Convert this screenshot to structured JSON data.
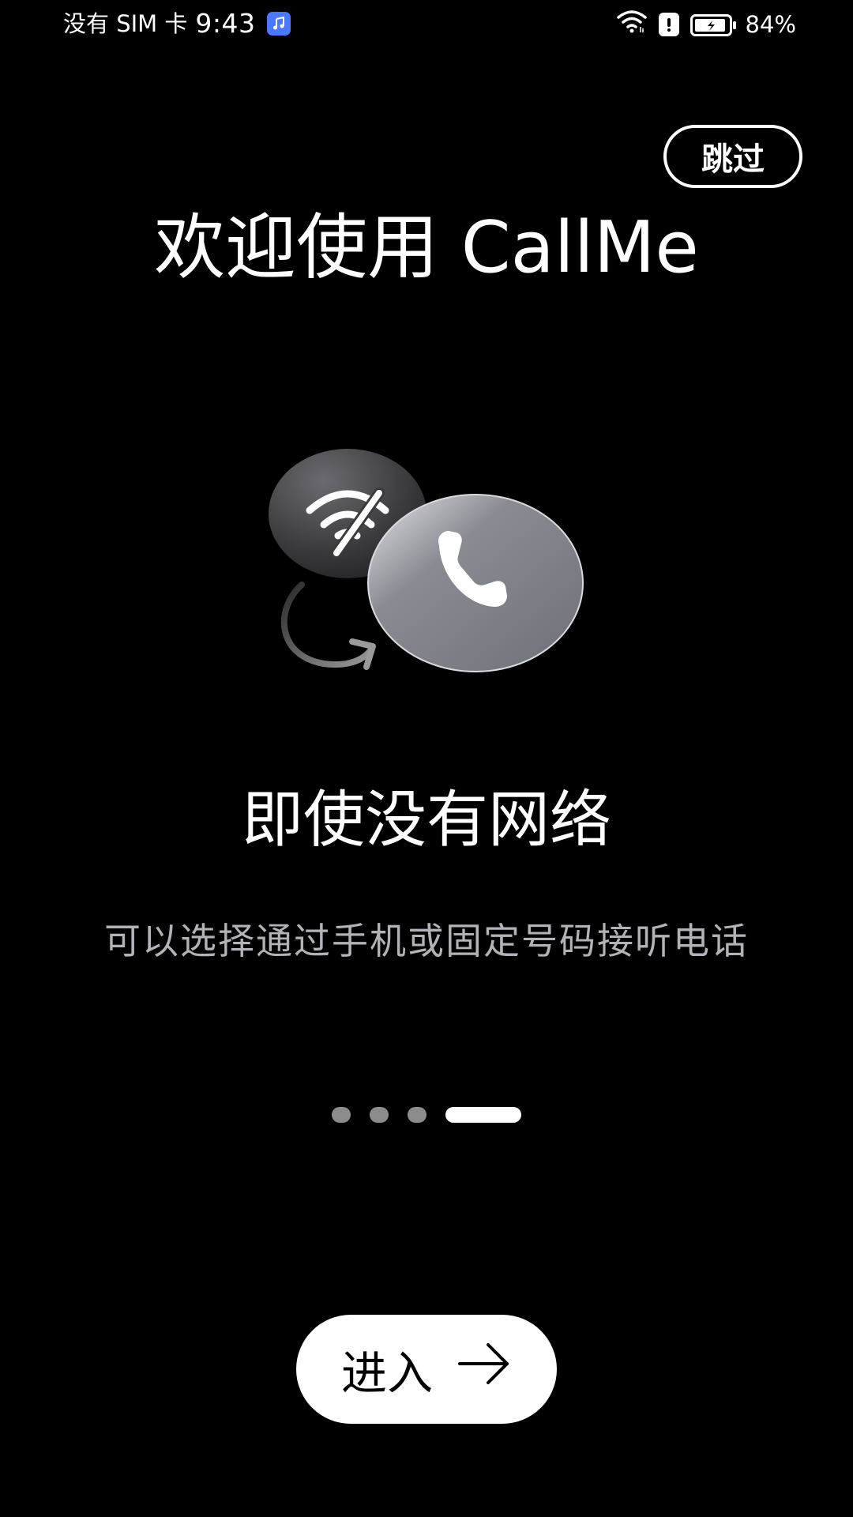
{
  "status_bar": {
    "carrier": "没有 SIM 卡",
    "time": "9:43",
    "battery": "84%"
  },
  "skip_button": {
    "label": "跳过"
  },
  "welcome": {
    "title": "欢迎使用 CallMe"
  },
  "feature": {
    "heading": "即使没有网络",
    "description": "可以选择通过手机或固定号码接听电话"
  },
  "pager": {
    "total": 4,
    "current": 4
  },
  "enter_button": {
    "label": "进入"
  },
  "icons": [
    "music-app-icon",
    "wifi-icon",
    "alert-icon",
    "battery-icon",
    "no-wifi-icon",
    "curved-arrow-icon",
    "phone-icon",
    "arrow-right-icon"
  ],
  "colors": {
    "background": "#000000",
    "foreground": "#ffffff",
    "description": "#b2b2b8",
    "inactive_dot": "#8c8c8c",
    "music_icon": "#4b78ff"
  }
}
